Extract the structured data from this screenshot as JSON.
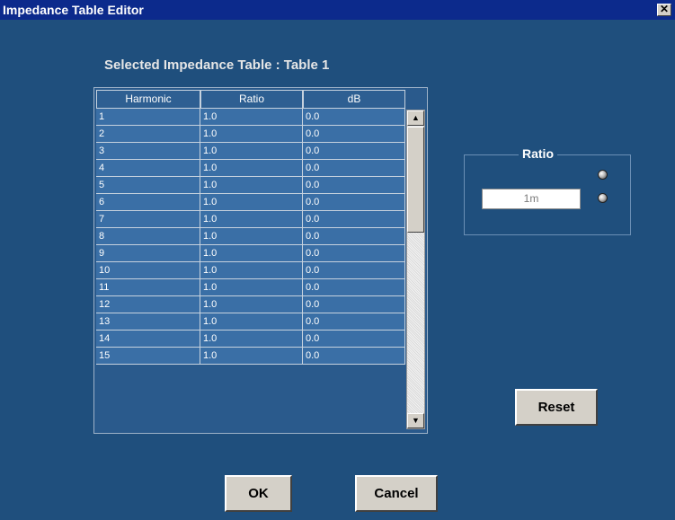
{
  "window": {
    "title": "Impedance Table Editor",
    "close_glyph": "✕"
  },
  "subtitle": "Selected Impedance Table : Table 1",
  "table": {
    "headers": [
      "Harmonic",
      "Ratio",
      "dB"
    ],
    "rows": [
      [
        "1",
        "1.0",
        "0.0"
      ],
      [
        "2",
        "1.0",
        "0.0"
      ],
      [
        "3",
        "1.0",
        "0.0"
      ],
      [
        "4",
        "1.0",
        "0.0"
      ],
      [
        "5",
        "1.0",
        "0.0"
      ],
      [
        "6",
        "1.0",
        "0.0"
      ],
      [
        "7",
        "1.0",
        "0.0"
      ],
      [
        "8",
        "1.0",
        "0.0"
      ],
      [
        "9",
        "1.0",
        "0.0"
      ],
      [
        "10",
        "1.0",
        "0.0"
      ],
      [
        "11",
        "1.0",
        "0.0"
      ],
      [
        "12",
        "1.0",
        "0.0"
      ],
      [
        "13",
        "1.0",
        "0.0"
      ],
      [
        "14",
        "1.0",
        "0.0"
      ],
      [
        "15",
        "1.0",
        "0.0"
      ]
    ],
    "scroll_up_glyph": "▲",
    "scroll_down_glyph": "▼"
  },
  "ratio_panel": {
    "label": "Ratio",
    "input_value": "1m"
  },
  "buttons": {
    "reset": "Reset",
    "ok": "OK",
    "cancel": "Cancel"
  },
  "colors": {
    "background": "#1f4f7d",
    "titlebar": "#0c2a8c",
    "cell": "#3a6fa6",
    "button_face": "#d4d0c8"
  }
}
